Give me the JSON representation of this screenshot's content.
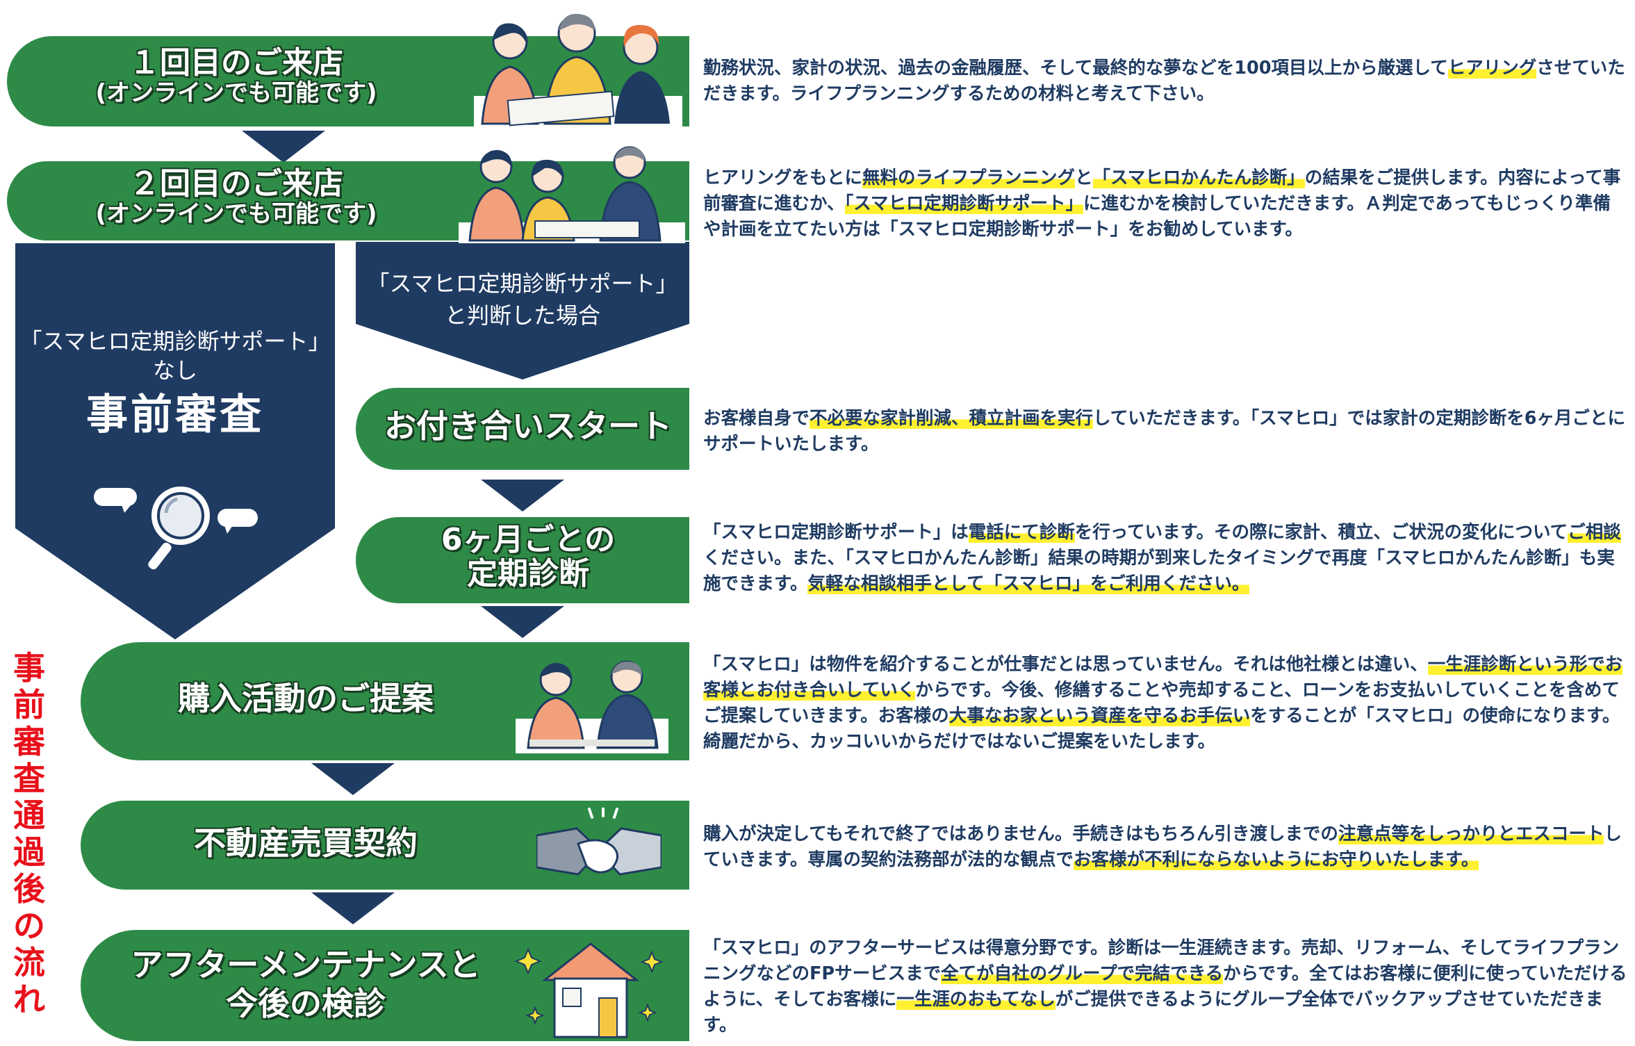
{
  "steps": {
    "visit1": {
      "line1": "１回目のご来店",
      "line2": "(オンラインでも可能です)"
    },
    "visit2": {
      "line1": "２回目のご来店",
      "line2": "(オンラインでも可能です)"
    },
    "start": {
      "label": "お付き合いスタート"
    },
    "checkup": {
      "line1": "6ヶ月ごとの",
      "line2": "定期診断"
    },
    "purchase": {
      "label": "購入活動のご提案"
    },
    "contract": {
      "label": "不動産売買契約"
    },
    "after": {
      "line1": "アフターメンテナンスと",
      "line2": "今後の検診"
    }
  },
  "branch_left": {
    "line1": "「スマヒロ定期診断サポート」",
    "line2": "なし",
    "title": "事前審査"
  },
  "branch_right": {
    "line1": "「スマヒロ定期診断サポート」",
    "line2": "と判断した場合"
  },
  "side_title": [
    "事",
    "前",
    "審",
    "査",
    "通",
    "過",
    "後",
    "の",
    "流",
    "れ"
  ],
  "descriptions": {
    "d1": [
      "勤務状況、家計の状況、過去の金融履歴、そして最終的な夢などを100項目以上から厳選して",
      "ヒアリング",
      "させていただきます。ライフプランニングするための材料と考えて下さい。"
    ],
    "d2": [
      "ヒアリングをもとに",
      "無料のライフプランニング",
      "と",
      "「スマヒロかんたん診断」",
      "の結果をご提供します。内容によって事前審査に進むか、",
      "「スマヒロ定期診断サポート」",
      "に進むかを検討していただきます。Ａ判定であってもじっくり準備や計画を立てたい方は「スマヒロ定期診断サポート」をお勧めしています。"
    ],
    "d3": [
      "お客様自身で",
      "不必要な家計削減、積立計画を実行",
      "していただきます。「スマヒロ」では家計の定期診断を6ヶ月ごとにサポートいたします。"
    ],
    "d4": [
      "「スマヒロ定期診断サポート」は",
      "電話にて診断",
      "を行っています。その際に家計、積立、ご状況の変化について",
      "ご相談",
      "ください。また、「スマヒロかんたん診断」結果の時期が到来したタイミングで再度「スマヒロかんたん診断」も実施できます。",
      "気軽な相談相手として「スマヒロ」をご利用ください。"
    ],
    "d5": [
      "「スマヒロ」は物件を紹介することが仕事だとは思っていません。それは他社様とは違い、",
      "一生涯診断という形でお客様とお付き合いしていく",
      "からです。今後、修繕することや売却すること、ローンをお支払いしていくことを含めてご提案していきます。お客様の",
      "大事なお家という資産を守るお手伝い",
      "をすることが「スマヒロ」の使命になります。綺麗だから、カッコいいからだけではないご提案をいたします。"
    ],
    "d6": [
      "購入が決定してもそれで終了ではありません。手続きはもちろん引き渡しまでの",
      "注意点等をしっかりとエスコート",
      "していきます。専属の契約法務部が法的な観点で",
      "お客様が不利にならないようにお守りいたします。"
    ],
    "d7": [
      "「スマヒロ」のアフターサービスは得意分野です。診断は一生涯続きます。売却、リフォーム、そしてライフプランニングなどのFPサービスまで",
      "全てが自社のグループで完結できる",
      "からです。全てはお客様に便利に使っていただけるように、そしてお客様に",
      "一生涯のおもてなし",
      "がご提供できるようにグループ全体でバックアップさせていただきます。"
    ]
  },
  "colors": {
    "green": "#2e8b47",
    "navy": "#1f3b62",
    "highlight": "#fff030",
    "red": "#e8101a"
  },
  "icons": [
    "meeting-three-people-icon",
    "meeting-consultation-icon",
    "magnifier-icon",
    "consultant-meeting-icon",
    "handshake-icon",
    "house-sparkle-icon"
  ]
}
